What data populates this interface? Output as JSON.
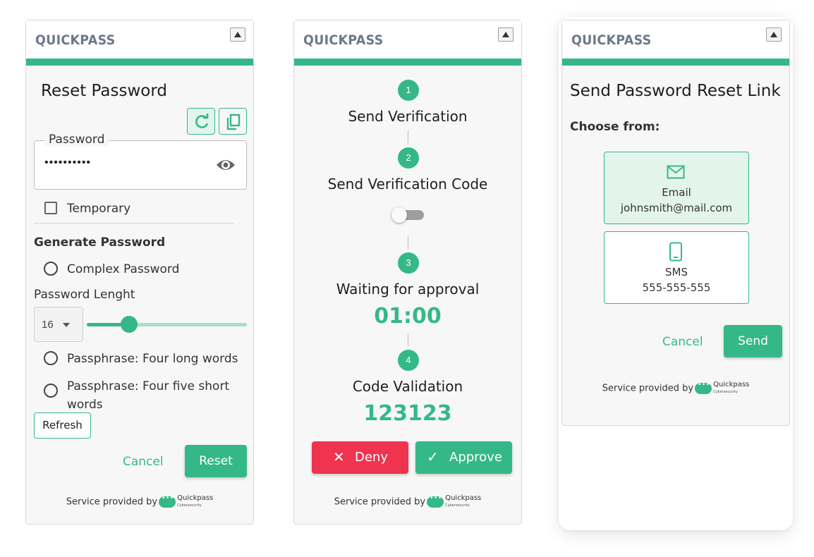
{
  "brand": "QUICKPASS",
  "footer": {
    "prefix": "Service provided by",
    "logo_name": "Quickpass",
    "logo_sub": "Cybersecurity"
  },
  "colors": {
    "accent": "#35b888",
    "deny": "#f0334f",
    "brand_text": "#6c7889"
  },
  "reset_panel": {
    "title": "Reset Password",
    "password_label": "Password",
    "password_value": "••••••••••",
    "temporary_label": "Temporary",
    "temporary_checked": false,
    "generate_heading": "Generate Password",
    "complex_label": "Complex Password",
    "length_label": "Password Lenght",
    "length_value": "16",
    "slider_fraction": 0.26,
    "passphrase_long_label": "Passphrase: Four long words",
    "passphrase_short_label": "Passphrase: Four five short words",
    "refresh_label": "Refresh",
    "cancel_label": "Cancel",
    "reset_label": "Reset",
    "icons": [
      "refresh-icon",
      "copy-icon",
      "eye-icon"
    ]
  },
  "approval_panel": {
    "steps": [
      {
        "number": "1",
        "title": "Send Verification"
      },
      {
        "number": "2",
        "title": "Send Verification Code"
      },
      {
        "number": "3",
        "title": "Waiting for approval"
      },
      {
        "number": "4",
        "title": "Code Validation"
      }
    ],
    "toggle_on": false,
    "timer": "01:00",
    "code": "123123",
    "deny_label": "Deny",
    "approve_label": "Approve"
  },
  "link_panel": {
    "title": "Send Password Reset Link",
    "choose_label": "Choose from:",
    "options": [
      {
        "type": "Email",
        "value": "johnsmith@mail.com",
        "icon": "mail-icon",
        "selected": true
      },
      {
        "type": "SMS",
        "value": "555-555-555",
        "icon": "phone-icon",
        "selected": false
      }
    ],
    "cancel_label": "Cancel",
    "send_label": "Send"
  }
}
